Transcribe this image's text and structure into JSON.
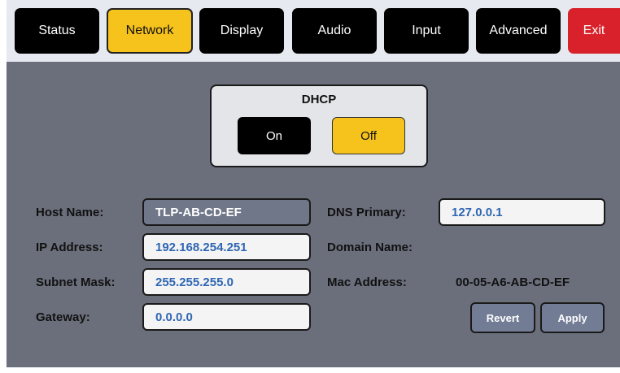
{
  "tabs": {
    "status": "Status",
    "network": "Network",
    "display": "Display",
    "audio": "Audio",
    "input": "Input",
    "advanced": "Advanced",
    "exit": "Exit"
  },
  "active_tab": "Network",
  "dhcp": {
    "title": "DHCP",
    "on_label": "On",
    "off_label": "Off",
    "selected": "Off"
  },
  "network": {
    "host_name_label": "Host Name:",
    "host_name_value": "TLP-AB-CD-EF",
    "ip_address_label": "IP Address:",
    "ip_address_value": "192.168.254.251",
    "subnet_mask_label": "Subnet Mask:",
    "subnet_mask_value": "255.255.255.0",
    "gateway_label": "Gateway:",
    "gateway_value": "0.0.0.0",
    "dns_primary_label": "DNS Primary:",
    "dns_primary_value": "127.0.0.1",
    "domain_name_label": "Domain Name:",
    "mac_address_label": "Mac Address:",
    "mac_address_value": "00-05-A6-AB-CD-EF"
  },
  "actions": {
    "revert": "Revert",
    "apply": "Apply"
  },
  "colors": {
    "active": "#f6c21c",
    "exit": "#d8212a",
    "panel": "#6b6f7c",
    "value_text": "#2f66b3"
  }
}
